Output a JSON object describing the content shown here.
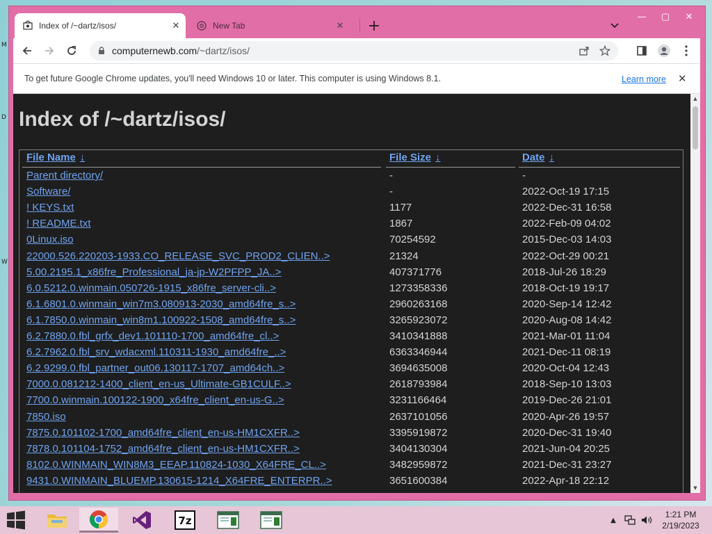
{
  "colors": {
    "window_frame": "#e26ea8",
    "page_bg": "#1e1e1e",
    "link": "#6fa3ef",
    "text": "#d4d4d4",
    "accent_link": "#1a73e8"
  },
  "tabs": [
    {
      "title": "Index of /~dartz/isos/",
      "icon": "favicon-icon",
      "active": true
    },
    {
      "title": "New Tab",
      "icon": "chrome-icon",
      "active": false
    }
  ],
  "toolbar": {
    "url_host": "computernewb.com",
    "url_path": "/~dartz/isos/"
  },
  "infobar": {
    "message": "To get future Google Chrome updates, you'll need Windows 10 or later. This computer is using Windows 8.1.",
    "link": "Learn more"
  },
  "page": {
    "heading": "Index of /~dartz/isos/",
    "columns": {
      "name": "File Name",
      "size": "File Size",
      "date": "Date",
      "sort_arrow": "↓"
    },
    "rows": [
      {
        "name": "Parent directory/",
        "size": "-",
        "date": "-"
      },
      {
        "name": "Software/",
        "size": "-",
        "date": "2022-Oct-19 17:15"
      },
      {
        "name": "! KEYS.txt",
        "size": "1177",
        "date": "2022-Dec-31 16:58"
      },
      {
        "name": "! README.txt",
        "size": "1867",
        "date": "2022-Feb-09 04:02"
      },
      {
        "name": "0Linux.iso",
        "size": "70254592",
        "date": "2015-Dec-03 14:03"
      },
      {
        "name": "22000.526.220203-1933.CO_RELEASE_SVC_PROD2_CLIEN..>",
        "size": "21324",
        "date": "2022-Oct-29 00:21"
      },
      {
        "name": "5.00.2195.1_x86fre_Professional_ja-jp-W2PFPP_JA..>",
        "size": "407371776",
        "date": "2018-Jul-26 18:29"
      },
      {
        "name": "6.0.5212.0.winmain.050726-1915_x86fre_server-cli..>",
        "size": "1273358336",
        "date": "2018-Oct-19 19:17"
      },
      {
        "name": "6.1.6801.0.winmain_win7m3.080913-2030_amd64fre_s..>",
        "size": "2960263168",
        "date": "2020-Sep-14 12:42"
      },
      {
        "name": "6.1.7850.0.winmain_win8m1.100922-1508_amd64fre_s..>",
        "size": "3265923072",
        "date": "2020-Aug-08 14:42"
      },
      {
        "name": "6.2.7880.0.fbl_grfx_dev1.101110-1700_amd64fre_cl..>",
        "size": "3410341888",
        "date": "2021-Mar-01 11:04"
      },
      {
        "name": "6.2.7962.0.fbl_srv_wdacxml.110311-1930_amd64fre_..>",
        "size": "6363346944",
        "date": "2021-Dec-11 08:19"
      },
      {
        "name": "6.2.9299.0.fbl_partner_out06.130117-1707_amd64ch..>",
        "size": "3694635008",
        "date": "2020-Oct-04 12:43"
      },
      {
        "name": "7000.0.081212-1400_client_en-us_Ultimate-GB1CULF..>",
        "size": "2618793984",
        "date": "2018-Sep-10 13:03"
      },
      {
        "name": "7700.0.winmain.100122-1900_x64fre_client_en-us-G..>",
        "size": "3231166464",
        "date": "2019-Dec-26 21:01"
      },
      {
        "name": "7850.iso",
        "size": "2637101056",
        "date": "2020-Apr-26 19:57"
      },
      {
        "name": "7875.0.101102-1700_amd64fre_client_en-us-HM1CXFR..>",
        "size": "3395919872",
        "date": "2020-Dec-31 19:40"
      },
      {
        "name": "7878.0.101104-1752_amd64fre_client_en-us-HM1CXFR..>",
        "size": "3404130304",
        "date": "2021-Jun-04 20:25"
      },
      {
        "name": "8102.0.WINMAIN_WIN8M3_EEAP.110824-1030_X64FRE_CL..>",
        "size": "3482959872",
        "date": "2021-Dec-31 23:27"
      },
      {
        "name": "9431.0.WINMAIN_BLUEMP.130615-1214_X64FRE_ENTERPR..>",
        "size": "3651600384",
        "date": "2022-Apr-18 22:12"
      }
    ]
  },
  "taskbar": {
    "apps": [
      {
        "name": "file-explorer",
        "icon": "folder-icon"
      },
      {
        "name": "chrome",
        "icon": "chrome-icon",
        "active": true
      },
      {
        "name": "visual-studio",
        "icon": "visual-studio-icon"
      },
      {
        "name": "7zip",
        "icon": "7zip-icon",
        "label": "7z"
      },
      {
        "name": "window-1",
        "icon": "window-icon"
      },
      {
        "name": "window-2",
        "icon": "window-icon"
      }
    ],
    "clock_time": "1:21 PM",
    "clock_date": "2/19/2023"
  }
}
